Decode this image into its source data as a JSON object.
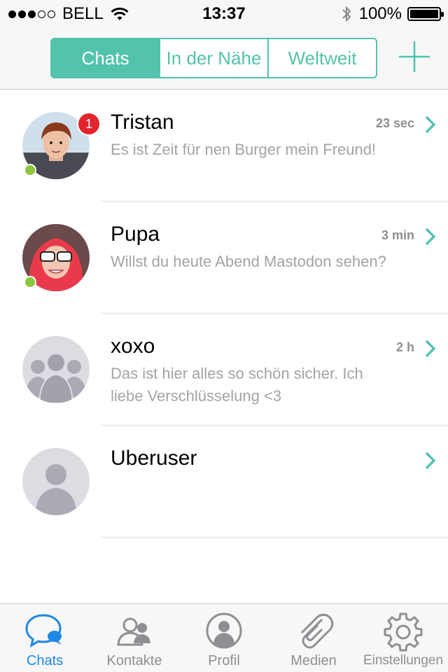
{
  "status_bar": {
    "carrier": "BELL",
    "time": "13:37",
    "battery": "100%",
    "signal_icon": "signal-dots-icon",
    "wifi_icon": "wifi-icon",
    "bluetooth_icon": "bluetooth-icon"
  },
  "nav": {
    "segments": [
      {
        "label": "Chats",
        "active": true
      },
      {
        "label": "In der Nähe",
        "active": false
      },
      {
        "label": "Weltweit",
        "active": false
      }
    ],
    "add_icon": "plus-icon"
  },
  "chats": [
    {
      "name": "Tristan",
      "time": "23 sec",
      "preview": "Es ist Zeit für nen Burger mein Freund!",
      "unread": "1",
      "online": true
    },
    {
      "name": "Pupa",
      "time": "3 min",
      "preview": "Willst du heute Abend Mastodon sehen?",
      "unread": "",
      "online": true
    },
    {
      "name": "xoxo",
      "time": "2 h",
      "preview": "Das ist hier alles so schön sicher. Ich liebe Verschlüsselung <3",
      "unread": "",
      "online": false
    },
    {
      "name": "Uberuser",
      "time": "",
      "preview": "",
      "unread": "",
      "online": false
    }
  ],
  "tabs": [
    {
      "label": "Chats",
      "icon": "chat-bubble-icon",
      "active": true
    },
    {
      "label": "Kontakte",
      "icon": "contacts-icon",
      "active": false
    },
    {
      "label": "Profil",
      "icon": "profile-icon",
      "active": false
    },
    {
      "label": "Medien",
      "icon": "paperclip-icon",
      "active": false
    },
    {
      "label": "Einstellungen",
      "icon": "gear-icon",
      "active": false
    }
  ],
  "colors": {
    "accent": "#53c3ab",
    "tab_active": "#1e88e5",
    "badge": "#e3242b",
    "online": "#8cc63e"
  }
}
